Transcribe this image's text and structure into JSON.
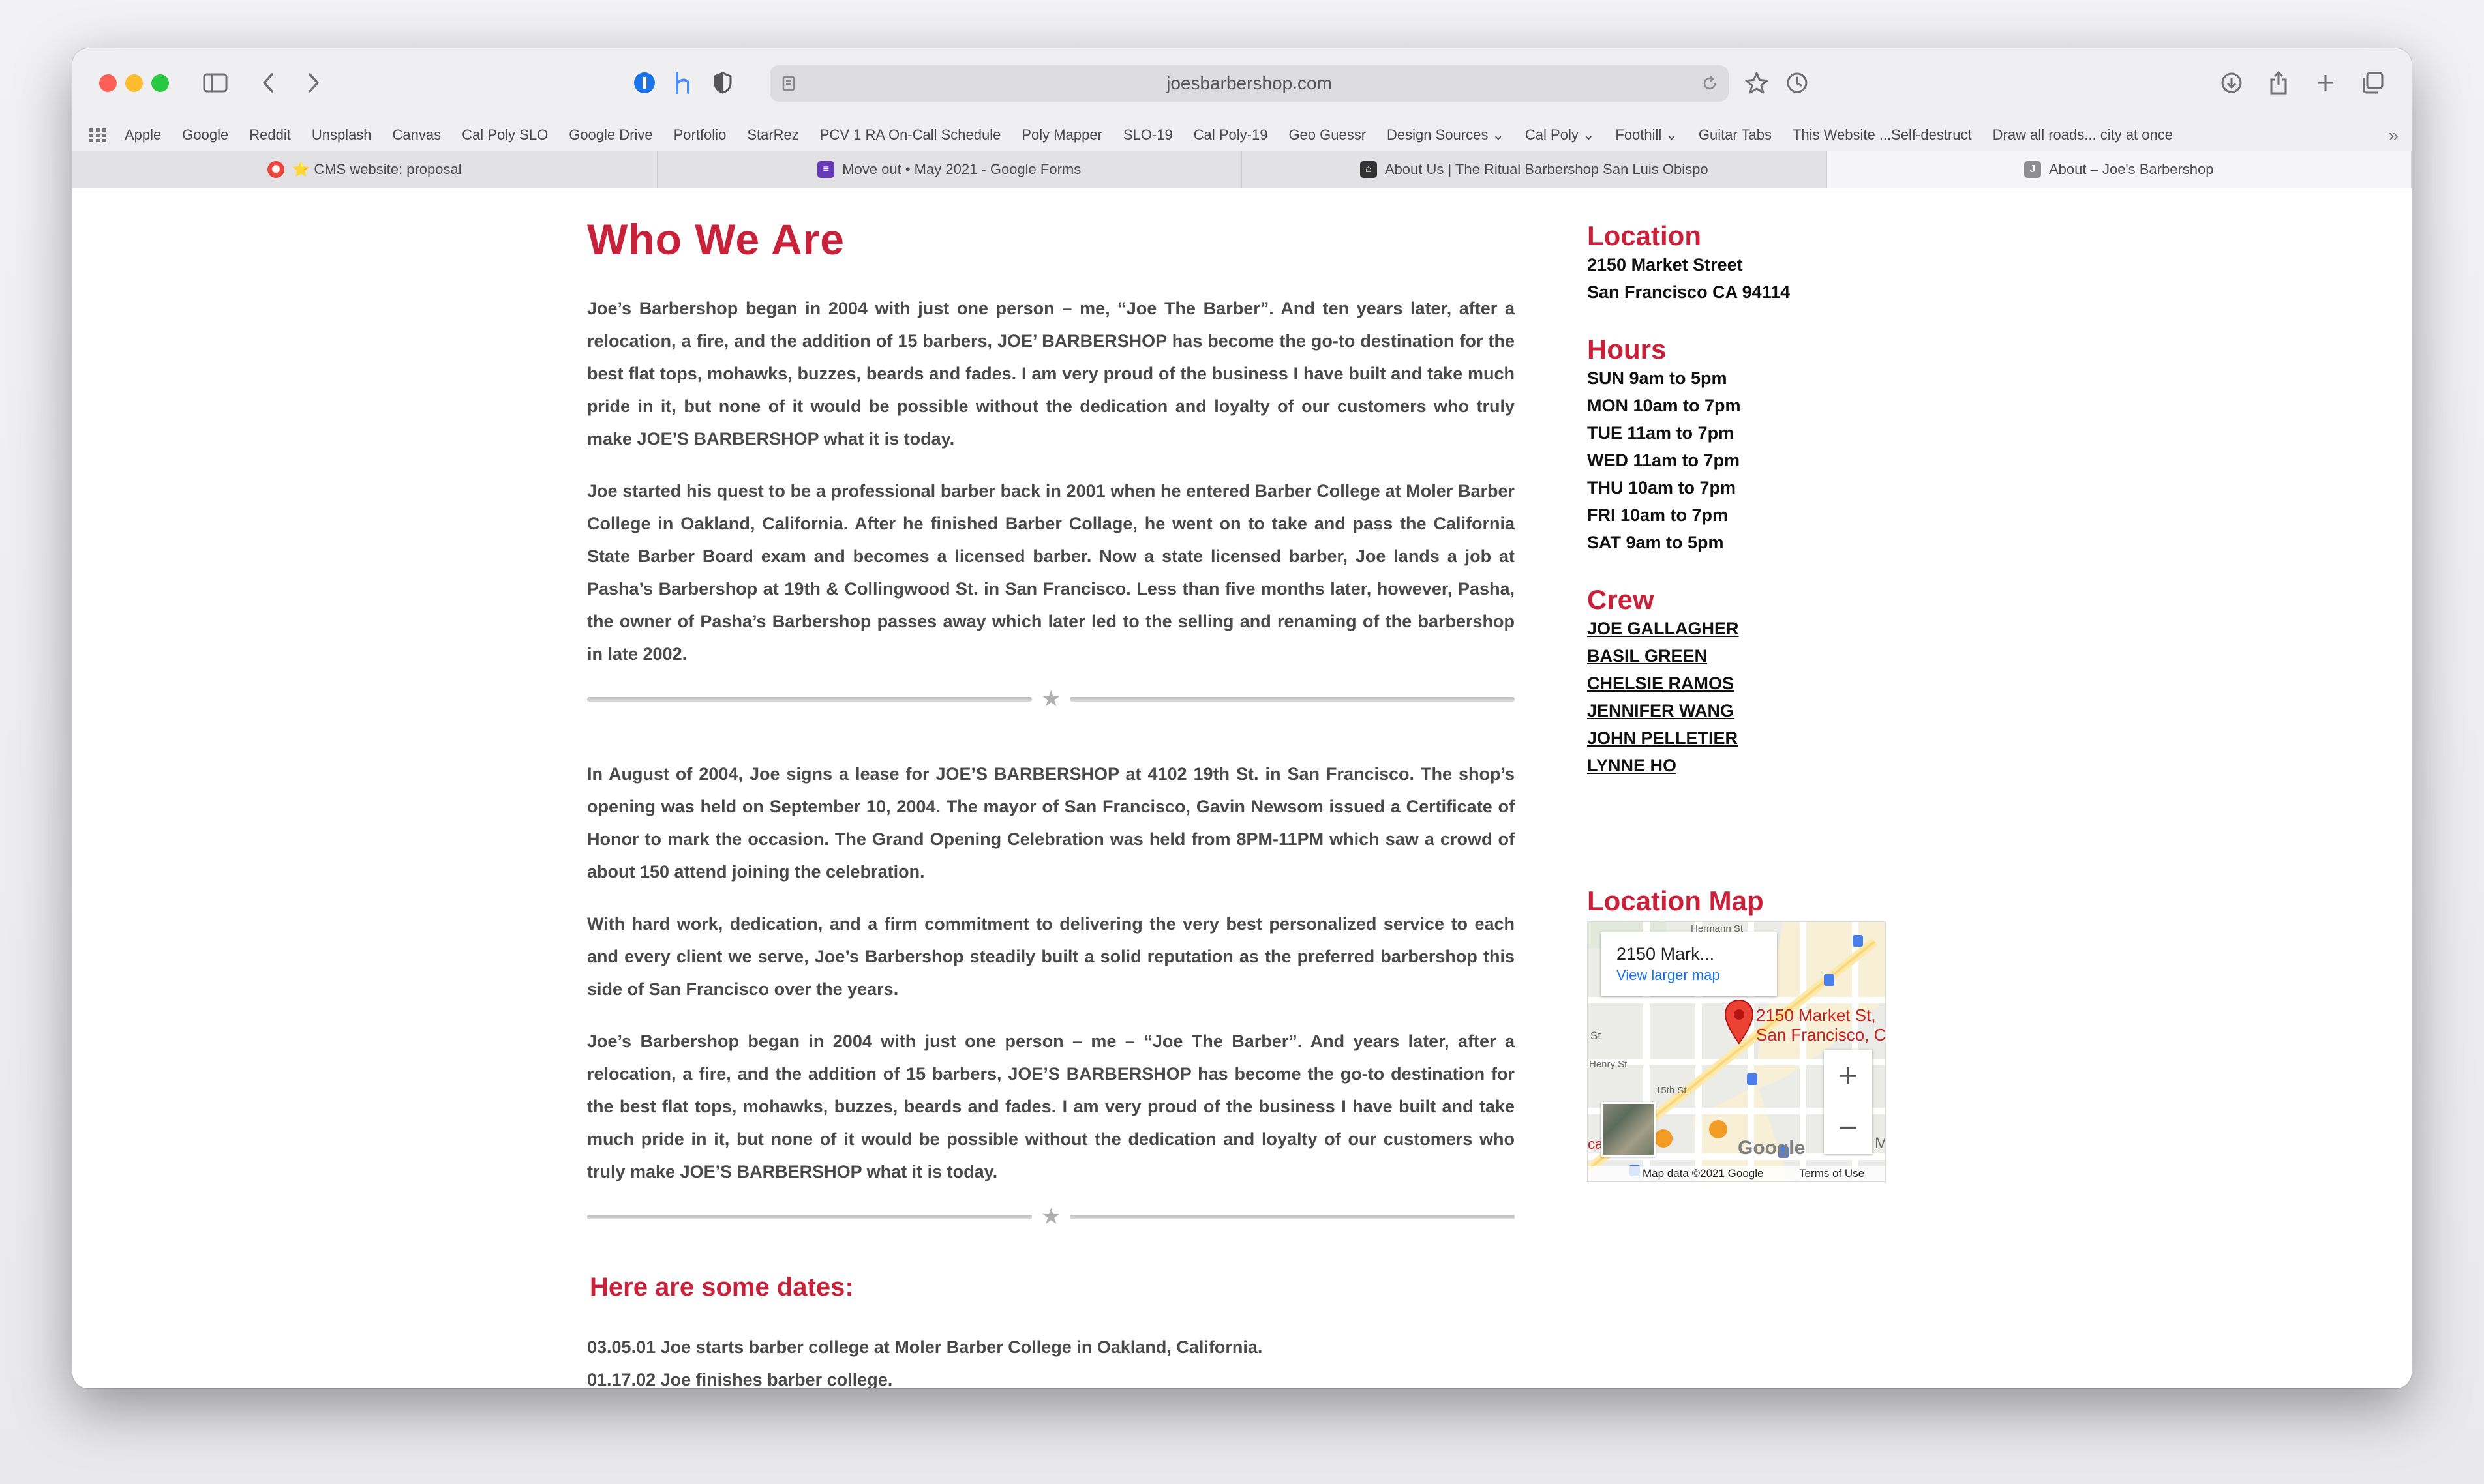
{
  "browser": {
    "url": "joesbarbershop.com",
    "bookmarks": [
      "Apple",
      "Google",
      "Reddit",
      "Unsplash",
      "Canvas",
      "Cal Poly SLO",
      "Google Drive",
      "Portfolio",
      "StarRez",
      "PCV 1 RA On-Call Schedule",
      "Poly Mapper",
      "SLO-19",
      "Cal Poly-19",
      "Geo Guessr",
      "Design Sources ⌄",
      "Cal Poly ⌄",
      "Foothill ⌄",
      "Guitar Tabs",
      "This Website ...Self-destruct",
      "Draw all roads... city at once"
    ],
    "tabs": [
      {
        "label": "⭐ CMS website: proposal",
        "icon": "asu-logo-icon",
        "color": "#e8473f",
        "active": false
      },
      {
        "label": "Move out • May 2021 - Google Forms",
        "icon": "google-forms-icon",
        "color": "#673ab7",
        "active": false
      },
      {
        "label": "About Us | The Ritual Barbershop San Luis Obispo",
        "icon": "ritual-barbershop-icon",
        "color": "#333333",
        "active": false
      },
      {
        "label": "About – Joe's Barbershop",
        "icon": "joes-favicon-icon",
        "color": "#8e8e93",
        "letter": "J",
        "active": true
      }
    ]
  },
  "content": {
    "title": "Who We Are",
    "paragraphs": [
      "Joe’s Barbershop began in 2004 with just one person – me, “Joe The Barber”. And ten years later, after a relocation, a fire, and the addition of 15 barbers, JOE’ BARBERSHOP has become the go-to destination for the best flat tops, mohawks, buzzes, beards and fades. I am very proud of the business I have built and take much pride in it, but none of it would be possible without the dedication and loyalty of our customers who truly make JOE’S BARBERSHOP what it is today.",
      "Joe started his quest to be a professional barber back in 2001 when he entered Barber College at Moler Barber College in Oakland, California. After he finished Barber Collage, he went on to take and pass the California State Barber Board exam and becomes a licensed barber. Now a state licensed barber, Joe lands a job at Pasha’s Barbershop at 19th & Collingwood St. in San Francisco. Less than five months later, however, Pasha, the owner of Pasha’s Barbershop passes away which later led to the selling and renaming of the barbershop in late 2002.",
      "In August of 2004, Joe signs a lease for JOE’S BARBERSHOP at 4102 19th St. in San Francisco. The shop’s opening was held on September 10, 2004. The mayor of San Francisco, Gavin Newsom issued a Certificate of Honor to mark the occasion. The Grand Opening Celebration was held from 8PM-11PM which saw a crowd of about 150 attend joining the celebration.",
      "With hard work, dedication, and a firm commitment to delivering the very best personalized service to each and every client we serve, Joe’s Barbershop steadily built a solid reputation as the preferred barbershop this side of San Francisco over the years.",
      "Joe’s Barbershop began in 2004 with just one person – me – “Joe The Barber”. And  years later, after a relocation, a fire, and the addition of 15 barbers, JOE’S BARBERSHOP has become the go-to destination for the best flat tops, mohawks, buzzes, beards and fades. I am very proud of the business I have built and take much pride in it, but none of it would be possible without the dedication and loyalty of our customers who truly make JOE’S BARBERSHOP what it is today."
    ],
    "dates_heading": "Here are some dates:",
    "dates": [
      "03.05.01 Joe starts barber college at Moler Barber College in Oakland, California.",
      "01.17.02 Joe finishes barber college."
    ]
  },
  "sidebar": {
    "location_heading": "Location",
    "address_line1": "2150 Market Street",
    "address_line2": "San Francisco CA 94114",
    "hours_heading": "Hours",
    "hours": [
      "SUN 9am to 5pm",
      "MON 10am to 7pm",
      "TUE 11am to 7pm",
      "WED 11am to 7pm",
      "THU 10am to 7pm",
      "FRI 10am to 7pm",
      "SAT 9am to 5pm"
    ],
    "crew_heading": "Crew",
    "crew": [
      "JOE GALLAGHER",
      "BASIL GREEN",
      "CHELSIE RAMOS",
      "JENNIFER WANG",
      "JOHN PELLETIER",
      "LYNNE HO"
    ],
    "map_heading": "Location Map"
  },
  "map": {
    "card_title": "2150 Mark...",
    "card_link": "View larger map",
    "pin_label_line1": "2150 Market St,",
    "pin_label_line2": "San Francisco, C",
    "street_hermann": "Hermann St",
    "street_15th": "15th St",
    "street_henry": "Henry St",
    "street_st": "St",
    "edge_ca": "ca",
    "edge_m": "M",
    "zoom_in": "+",
    "zoom_out": "−",
    "logo": "Google",
    "footer_data": "Map data ©2021 Google",
    "footer_terms": "Terms of Use"
  },
  "colors": {
    "accent": "#c8213a",
    "text": "#4a4a4a",
    "link": "#1a73e8",
    "pin": "#ea4335"
  }
}
